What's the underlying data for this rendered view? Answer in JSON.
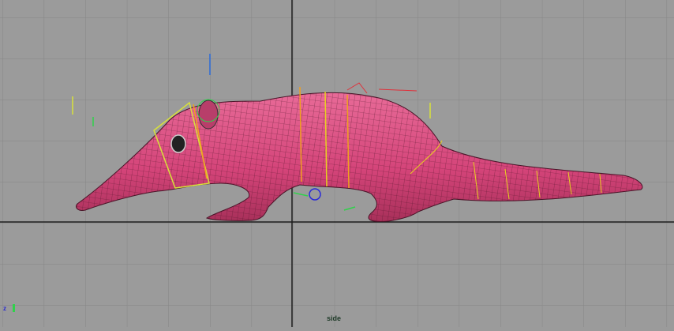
{
  "viewport": {
    "camera_name": "side",
    "axis_indicator": {
      "label": "z"
    },
    "colors": {
      "background": "#9b9b9b",
      "grid": "#858585",
      "axis_line": "#1c1c1c",
      "mesh": "#d6487a",
      "wire": "#3a1022",
      "rig_yellow": "#d8e23a",
      "rig_orange": "#f0a020",
      "rig_green": "#2fd24a",
      "rig_blue": "#2a2ad8",
      "rig_red": "#e0303a"
    }
  }
}
